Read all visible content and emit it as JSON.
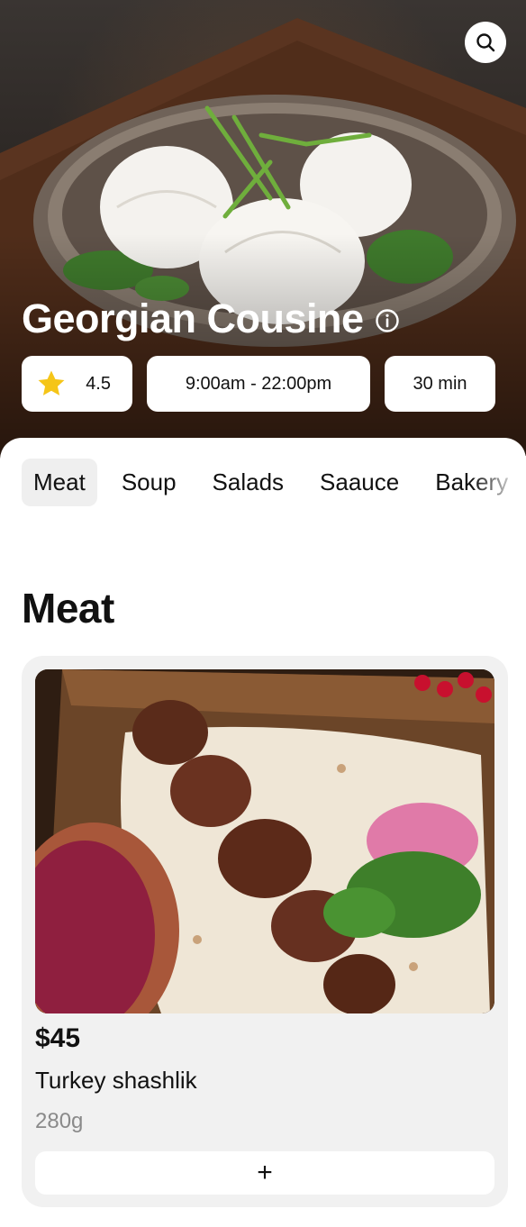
{
  "restaurant": {
    "name": "Georgian Cousine",
    "rating": "4.5",
    "hours": "9:00am - 22:00pm",
    "delivery_time": "30 min"
  },
  "icons": {
    "search": "search-icon",
    "info": "info-icon",
    "rating": "star-icon",
    "add": "plus-icon"
  },
  "colors": {
    "star": "#F5C518",
    "tab_active_bg": "#EFEFEF",
    "card_bg": "#F1F1F1"
  },
  "tabs": [
    {
      "label": "Meat",
      "active": true
    },
    {
      "label": "Soup",
      "active": false
    },
    {
      "label": "Salads",
      "active": false
    },
    {
      "label": "Saauce",
      "active": false
    },
    {
      "label": "Bakery",
      "active": false
    }
  ],
  "section": {
    "title": "Meat"
  },
  "products": [
    {
      "price": "$45",
      "name": "Turkey shashlik",
      "weight": "280g",
      "add_label": "+"
    }
  ]
}
